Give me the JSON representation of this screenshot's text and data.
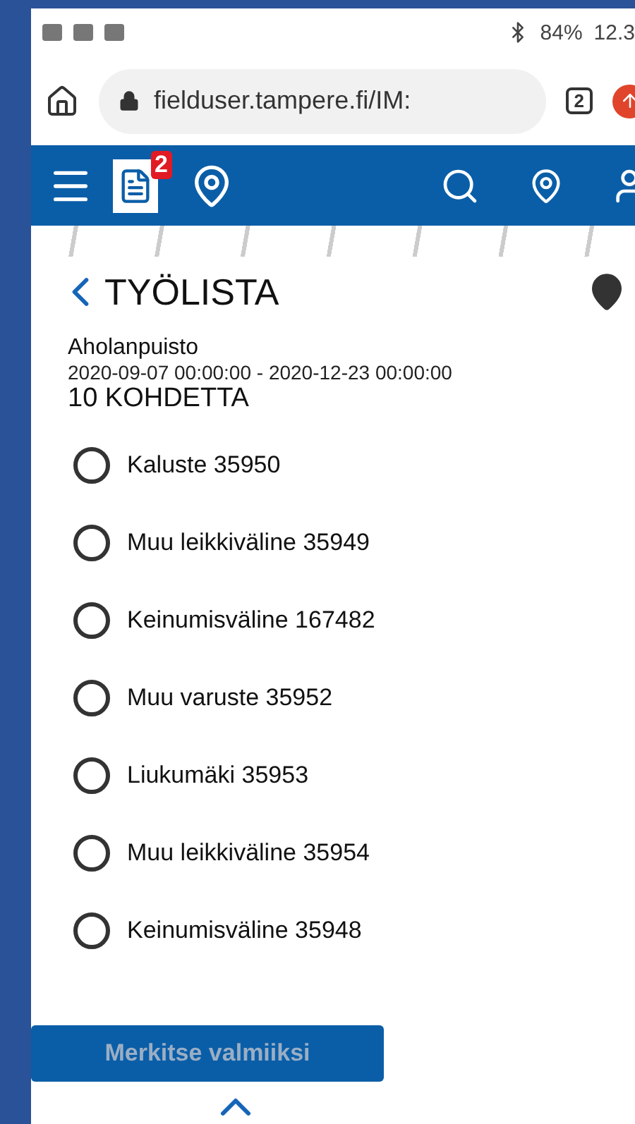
{
  "status_bar": {
    "battery": "84%",
    "time": "12.3"
  },
  "browser": {
    "url": "fielduser.tampere.fi/IM:",
    "tab_count": "2"
  },
  "toolbar": {
    "worklist_badge": "2"
  },
  "worklist": {
    "title": "TYÖLISTA",
    "location": "Aholanpuisto",
    "period": "2020-09-07 00:00:00 - 2020-12-23 00:00:00",
    "count": "10 KOHDETTA",
    "items": [
      {
        "label": "Kaluste 35950",
        "checked": false
      },
      {
        "label": "Muu leikkiväline 35949",
        "checked": false
      },
      {
        "label": "Keinumisväline 167482",
        "checked": false
      },
      {
        "label": "Muu varuste 35952",
        "checked": false
      },
      {
        "label": "Liukumäki 35953",
        "checked": false
      },
      {
        "label": "Muu leikkiväline 35954",
        "checked": false
      },
      {
        "label": "Keinumisväline 35948",
        "checked": false
      }
    ]
  },
  "footer": {
    "button": {
      "label": "Merkitse valmiiksi",
      "disabled": true
    }
  }
}
